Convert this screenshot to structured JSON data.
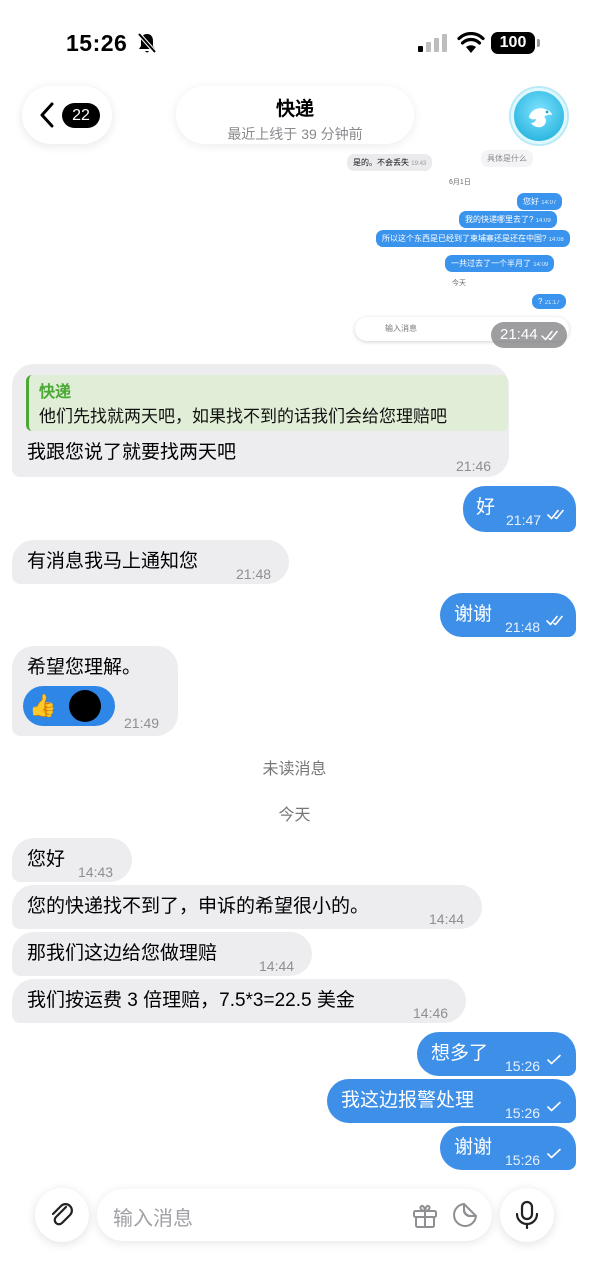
{
  "status_bar": {
    "time": "15:26",
    "battery": "100"
  },
  "header": {
    "back_badge": "22",
    "title": "快递",
    "subtitle": "最近上线于 39 分钟前"
  },
  "embedded_screenshot": {
    "partial_line": "具体是什么",
    "received_1": "是的。不会丢失",
    "received_1_time": "19:43",
    "date_1": "6月1日",
    "sent_1": "您好",
    "sent_1_time": "14:07",
    "sent_2": "我的快递哪里去了?",
    "sent_2_time": "14:09",
    "sent_3": "所以这个东西是已经到了柬埔寨还是还在中国?",
    "sent_3_time": "14:08",
    "sent_4": "一共过去了一个半月了",
    "sent_4_time": "14:09",
    "date_2": "今天",
    "sent_5": "?",
    "sent_5_time": "21:17",
    "input_placeholder": "输入消息",
    "overlay_time": "21:44"
  },
  "messages": [
    {
      "reply_name": "快递",
      "reply_text": "他们先找就两天吧，如果找不到的话我们会给您理赔吧",
      "text": "我跟您说了就要找两天吧",
      "time": "21:46"
    },
    {
      "text": "好",
      "time": "21:47"
    },
    {
      "text": "有消息我马上通知您",
      "time": "21:48"
    },
    {
      "text": "谢谢",
      "time": "21:48"
    },
    {
      "text": "希望您理解。",
      "time": "21:49",
      "reaction": "👍"
    },
    {
      "text": "您好",
      "time": "14:43"
    },
    {
      "text": "您的快递找不到了，申诉的希望很小的。",
      "time": "14:44"
    },
    {
      "text": "那我们这边给您做理赔",
      "time": "14:44"
    },
    {
      "text": "我们按运费 3 倍理赔，7.5*3=22.5 美金",
      "time": "14:46"
    },
    {
      "text": "想多了",
      "time": "15:26"
    },
    {
      "text": "我这边报警处理",
      "time": "15:26"
    },
    {
      "text": "谢谢",
      "time": "15:26"
    }
  ],
  "system": {
    "unread": "未读消息",
    "today": "今天"
  },
  "input_bar": {
    "placeholder": "输入消息"
  },
  "icons": {
    "status": [
      "bell-slash-icon",
      "signal-icon",
      "wifi-icon",
      "battery-icon"
    ],
    "header": [
      "chevron-left-icon",
      "dove-avatar"
    ],
    "input": [
      "paperclip-icon",
      "gift-icon",
      "sticker-icon",
      "microphone-icon"
    ]
  },
  "colors": {
    "outgoing_bubble": "#3d8fe8",
    "incoming_bubble": "#ededf0",
    "reply_accent": "#4ba835"
  }
}
